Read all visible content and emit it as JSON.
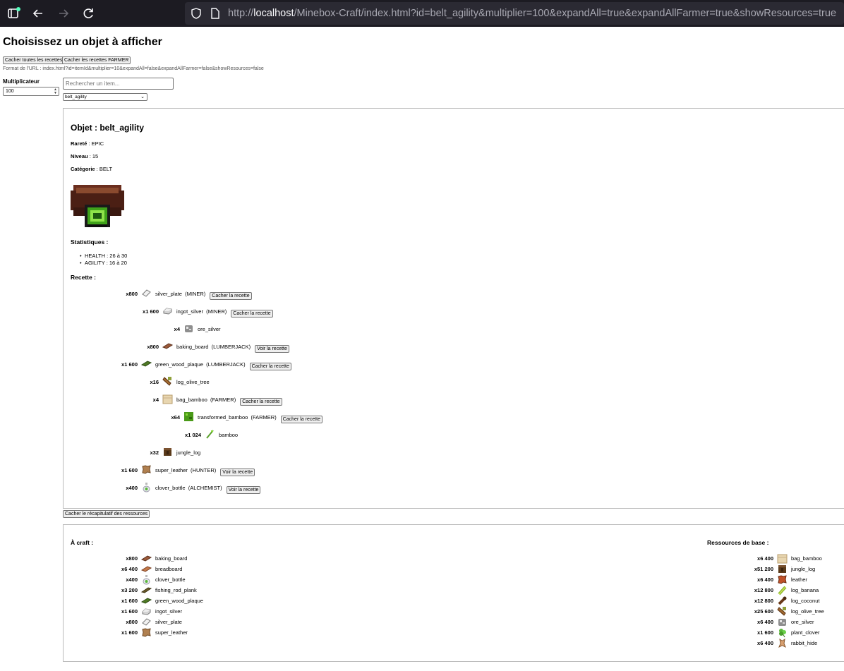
{
  "browser": {
    "url_prefix": "http://",
    "url_host": "localhost",
    "url_path": "/Minebox-Craft/index.html?id=belt_agility&multiplier=100&expandAll=true&expandAllFarmer=true&showResources=true"
  },
  "page": {
    "title": "Choisissez un objet à afficher",
    "hide_all_button": "Cacher toutes les recettes",
    "hide_farmer_button": "Cacher les recettes FARMER",
    "url_format": "Format de l'URL : index.html?id=itemId&multiplier=10&expandAll=false&expandAllFarmer=false&showResources=false",
    "multiplier_label": "Multiplicateur",
    "multiplier_value": "100",
    "search_placeholder": "Rechercher un item...",
    "selected_item": "belt_agility",
    "toggle_summary_button": "Cacher le récapitulatif des ressources"
  },
  "item": {
    "title": "Objet : belt_agility",
    "rarity_label": "Rareté",
    "rarity": "EPIC",
    "level_label": "Niveau",
    "level": "15",
    "category_label": "Catégorie",
    "category": "BELT",
    "stats_title": "Statistiques :",
    "stats": [
      "HEALTH : 26 à 30",
      "AGILITY : 16 à 20"
    ],
    "recipe_title": "Recette :"
  },
  "recipe": [
    {
      "qty": "x800",
      "name": "silver_plate",
      "job": "(MINER)",
      "button": "Cacher la recette",
      "icon": "silver-plate-icon"
    },
    {
      "qty": "x1 600",
      "name": "ingot_silver",
      "job": "(MINER)",
      "button": "Cacher la recette",
      "icon": "ingot-silver-icon"
    },
    {
      "qty": "x4",
      "name": "ore_silver",
      "job": "",
      "button": "",
      "icon": "ore-silver-icon"
    },
    {
      "qty": "x800",
      "name": "baking_board",
      "job": "(LUMBERJACK)",
      "button": "Voir la recette",
      "icon": "baking-board-icon"
    },
    {
      "qty": "x1 600",
      "name": "green_wood_plaque",
      "job": "(LUMBERJACK)",
      "button": "Cacher la recette",
      "icon": "green-wood-plaque-icon"
    },
    {
      "qty": "x16",
      "name": "log_olive_tree",
      "job": "",
      "button": "",
      "icon": "log-olive-tree-icon"
    },
    {
      "qty": "x4",
      "name": "bag_bamboo",
      "job": "(FARMER)",
      "button": "Cacher la recette",
      "icon": "bag-bamboo-icon"
    },
    {
      "qty": "x64",
      "name": "transformed_bamboo",
      "job": "(FARMER)",
      "button": "Cacher la recette",
      "icon": "transformed-bamboo-icon"
    },
    {
      "qty": "x1 024",
      "name": "bamboo",
      "job": "",
      "button": "",
      "icon": "bamboo-icon"
    },
    {
      "qty": "x32",
      "name": "jungle_log",
      "job": "",
      "button": "",
      "icon": "jungle-log-icon"
    },
    {
      "qty": "x1 600",
      "name": "super_leather",
      "job": "(HUNTER)",
      "button": "Voir la recette",
      "icon": "super-leather-icon"
    },
    {
      "qty": "x400",
      "name": "clover_bottle",
      "job": "(ALCHEMIST)",
      "button": "Voir la recette",
      "icon": "clover-bottle-icon"
    }
  ],
  "summary": {
    "craft_title": "À craft :",
    "base_title": "Ressources de base :",
    "craft": [
      {
        "qty": "x800",
        "name": "baking_board",
        "icon": "baking-board-icon"
      },
      {
        "qty": "x6 400",
        "name": "breadboard",
        "icon": "breadboard-icon"
      },
      {
        "qty": "x400",
        "name": "clover_bottle",
        "icon": "clover-bottle-icon"
      },
      {
        "qty": "x3 200",
        "name": "fishing_rod_plank",
        "icon": "fishing-rod-plank-icon"
      },
      {
        "qty": "x1 600",
        "name": "green_wood_plaque",
        "icon": "green-wood-plaque-icon"
      },
      {
        "qty": "x1 600",
        "name": "ingot_silver",
        "icon": "ingot-silver-icon"
      },
      {
        "qty": "x800",
        "name": "silver_plate",
        "icon": "silver-plate-icon"
      },
      {
        "qty": "x1 600",
        "name": "super_leather",
        "icon": "super-leather-icon"
      }
    ],
    "base": [
      {
        "qty": "x6 400",
        "name": "bag_bamboo",
        "icon": "bag-bamboo-icon"
      },
      {
        "qty": "x51 200",
        "name": "jungle_log",
        "icon": "jungle-log-icon"
      },
      {
        "qty": "x6 400",
        "name": "leather",
        "icon": "leather-icon"
      },
      {
        "qty": "x12 800",
        "name": "log_banana",
        "icon": "log-banana-icon"
      },
      {
        "qty": "x12 800",
        "name": "log_coconut",
        "icon": "log-coconut-icon"
      },
      {
        "qty": "x25 600",
        "name": "log_olive_tree",
        "icon": "log-olive-tree-icon"
      },
      {
        "qty": "x6 400",
        "name": "ore_silver",
        "icon": "ore-silver-icon"
      },
      {
        "qty": "x1 600",
        "name": "plant_clover",
        "icon": "plant-clover-icon"
      },
      {
        "qty": "x6 400",
        "name": "rabbit_hide",
        "icon": "rabbit-hide-icon"
      }
    ]
  }
}
